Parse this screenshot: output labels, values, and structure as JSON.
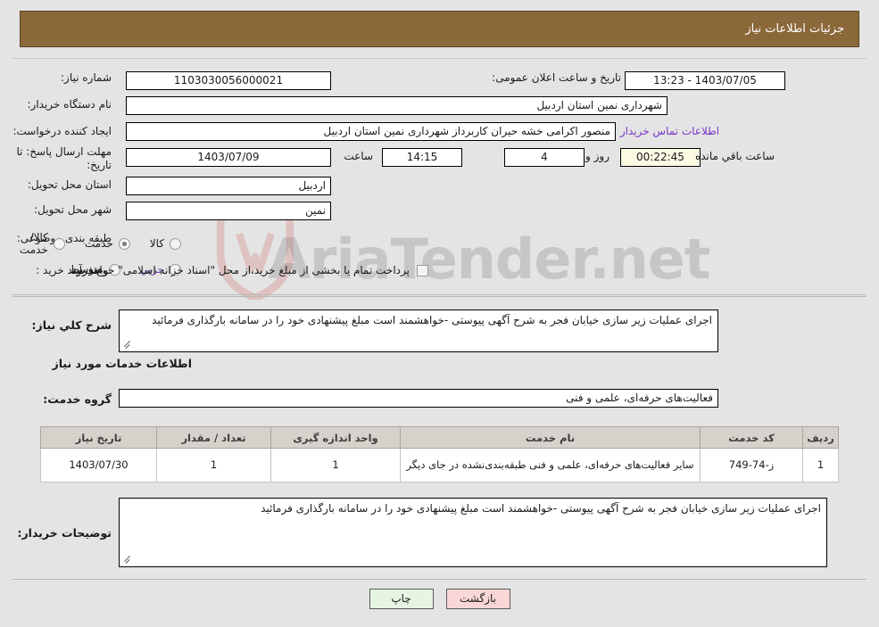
{
  "header": {
    "title": "جزئیات اطلاعات نیاز"
  },
  "form": {
    "need_number_label": "شماره نیاز:",
    "need_number_value": "1103030056000021",
    "announce_label": "تاریخ و ساعت اعلان عمومی:",
    "announce_value": "13:23 - 1403/07/05",
    "buyer_org_label": "نام دستگاه خریدار:",
    "buyer_org_value": "شهرداری نمین استان اردبیل",
    "requester_label": "ایجاد کننده درخواست:",
    "requester_value": "منصور اکرامی خشه حیران کاربرداز شهرداری نمین استان اردبیل",
    "contact_link": "اطلاعات تماس خریدار",
    "deadline_label": "مهلت ارسال پاسخ: تا تاریخ:",
    "deadline_date": "1403/07/09",
    "time_label": "ساعت",
    "deadline_time": "14:15",
    "days_value": "4",
    "days_label": "روز و",
    "countdown_value": "00:22:45",
    "remaining_label": "ساعت باقي مانده",
    "province_label": "استان محل تحویل:",
    "province_value": "اردبیل",
    "city_label": "شهر محل تحویل:",
    "city_value": "نمین",
    "category_label": "طبقه بندی موضوعی:",
    "category_options": [
      {
        "label": "کالا",
        "selected": false
      },
      {
        "label": "خدمت",
        "selected": true
      },
      {
        "label": "کالا/خدمت",
        "selected": false
      }
    ],
    "process_label": "نوع فرآیند خرید :",
    "process_options": [
      {
        "label": "جزیي",
        "selected": false
      },
      {
        "label": "متوسط",
        "selected": false
      }
    ],
    "treasury_checkbox_label": "پرداخت تمام یا بخشی از مبلغ خرید،از محل \"اسناد خزانه اسلامی\" خواهد بود.",
    "treasury_checked": false
  },
  "details": {
    "general_desc_label": "شرح کلي نیاز:",
    "general_desc_value": "اجرای عملیات زیر سازی خیابان فجر به شرح آگهی پیوستی -خواهشمند است مبلغ پیشنهادی خود را در سامانه بارگذاری فرمائید",
    "services_section_title": "اطلاعات خدمات مورد نیاز",
    "service_group_label": "گروه خدمت:",
    "service_group_value": "فعالیت‌های حرفه‌ای، علمی و فنی",
    "buyer_notes_label": "توضیحات خریدار:",
    "buyer_notes_value": "اجرای عملیات زیر سازی خیابان فجر به شرح آگهی پیوستی -خواهشمند است مبلغ پیشنهادی خود را در سامانه بارگذاری فرمائید"
  },
  "table": {
    "columns": [
      "ردیف",
      "کد خدمت",
      "نام خدمت",
      "واحد اندازه گیری",
      "تعداد / مقدار",
      "تاریخ نیاز"
    ],
    "rows": [
      {
        "row_no": "1",
        "service_code": "ز-74-749",
        "service_name": "سایر فعالیت‌های حرفه‌ای، علمی و فنی طبقه‌بندی‌نشده در جای دیگر",
        "unit": "1",
        "quantity": "1",
        "need_date": "1403/07/30"
      }
    ]
  },
  "footer": {
    "print_label": "چاپ",
    "back_label": "بازگشت"
  },
  "watermark": {
    "text": "AriaTender.net"
  },
  "colors": {
    "header_bg": "#8b6839",
    "page_bg": "#e4e4e4",
    "link": "#7a35c9",
    "table_header_bg": "#d6d2cb",
    "countdown_bg": "#fbfbe4",
    "print_btn_bg": "#e6f4e2",
    "back_btn_bg": "#f9d7d7"
  }
}
